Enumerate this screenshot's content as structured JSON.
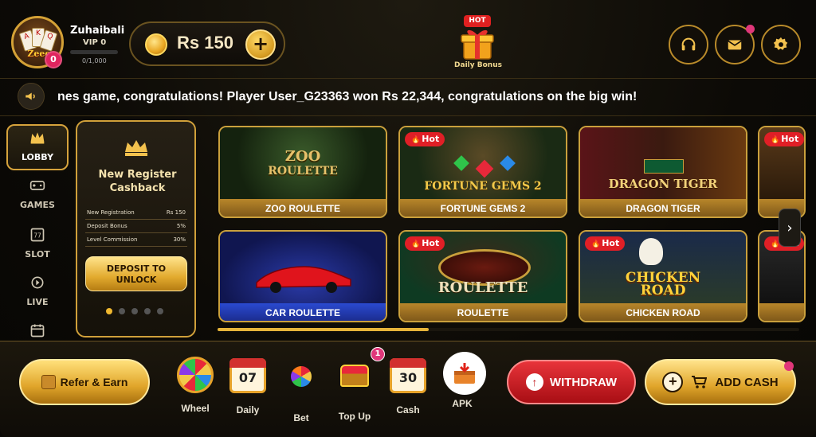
{
  "header": {
    "username": "Zuhaibali",
    "avatar_logo": "Zeeo",
    "avatar_badge": "0",
    "vip": "VIP 0",
    "vip_progress_text": "0/1,000",
    "vip_progress": 0,
    "balance": "Rs 150",
    "add_balance_label": "+",
    "daily_bonus_tag": "HOT",
    "daily_bonus_label": "Daily Bonus",
    "icons": [
      "headset-icon",
      "mail-icon",
      "settings-icon"
    ]
  },
  "marquee": {
    "text": "nes game, congratulations! Player User_G23363 won Rs 22,344, congratulations on the big win!"
  },
  "sidebar": {
    "items": [
      {
        "label": "LOBBY",
        "icon": "crown-icon",
        "active": true
      },
      {
        "label": "GAMES",
        "icon": "gamepad-icon",
        "active": false
      },
      {
        "label": "SLOT",
        "icon": "slot-icon",
        "active": false
      },
      {
        "label": "LIVE",
        "icon": "play-icon",
        "active": false
      },
      {
        "label": "",
        "icon": "calendar-icon",
        "active": false
      }
    ]
  },
  "promo": {
    "title_line1": "New Register",
    "title_line2": "Cashback",
    "rows": [
      {
        "label": "New Registration",
        "value": "Rs 150"
      },
      {
        "label": "Deposit Bonus",
        "value": "5%"
      },
      {
        "label": "Level Commission",
        "value": "30%"
      }
    ],
    "button": "DEPOSIT TO UNLOCK",
    "button_line1": "DEPOSIT TO",
    "button_line2": "UNLOCK",
    "active_slide": 0,
    "slides": 5
  },
  "games": [
    {
      "name": "ZOO ROULETTE",
      "logo": "ZOO ROULETTE",
      "logo_l1": "ZOO",
      "logo_l2": "ROULETTE",
      "hot": false
    },
    {
      "name": "FORTUNE GEMS 2",
      "logo": "FORTUNE GEMS 2",
      "hot": true,
      "hot_label": "Hot"
    },
    {
      "name": "DRAGON TIGER",
      "logo": "DRAGON TIGER",
      "hot": false
    },
    {
      "name": "CAR ROULETTE",
      "logo": "CAR ROULETTE",
      "hot": false
    },
    {
      "name": "ROULETTE",
      "logo": "ROULETTE",
      "hot": true,
      "hot_label": "Hot"
    },
    {
      "name": "CHICKEN ROAD",
      "logo": "CHICKEN ROAD",
      "logo_l1": "CHICKEN",
      "logo_l2": "ROAD",
      "hot": true,
      "hot_label": "Hot"
    }
  ],
  "partial_hot_label": "Hot",
  "bottom": {
    "refer": "Refer & Earn",
    "items": [
      {
        "label": "Wheel",
        "icon": "wheel-icon"
      },
      {
        "label": "Daily",
        "icon": "calendar-icon",
        "value": "07"
      },
      {
        "label": "Bet",
        "icon": "bet-wheel-icon"
      },
      {
        "label": "Top Up",
        "icon": "treasure-chest-icon",
        "badge": "1"
      },
      {
        "label": "Cash",
        "icon": "calendar-icon",
        "value": "30"
      },
      {
        "label": "APK",
        "icon": "download-box-icon"
      }
    ],
    "withdraw": "WITHDRAW",
    "add_cash": "ADD CASH"
  },
  "colors": {
    "gold": "#d4a136",
    "hot_red": "#e01f26",
    "withdraw_red": "#c8141a",
    "badge_pink": "#e0377a"
  }
}
